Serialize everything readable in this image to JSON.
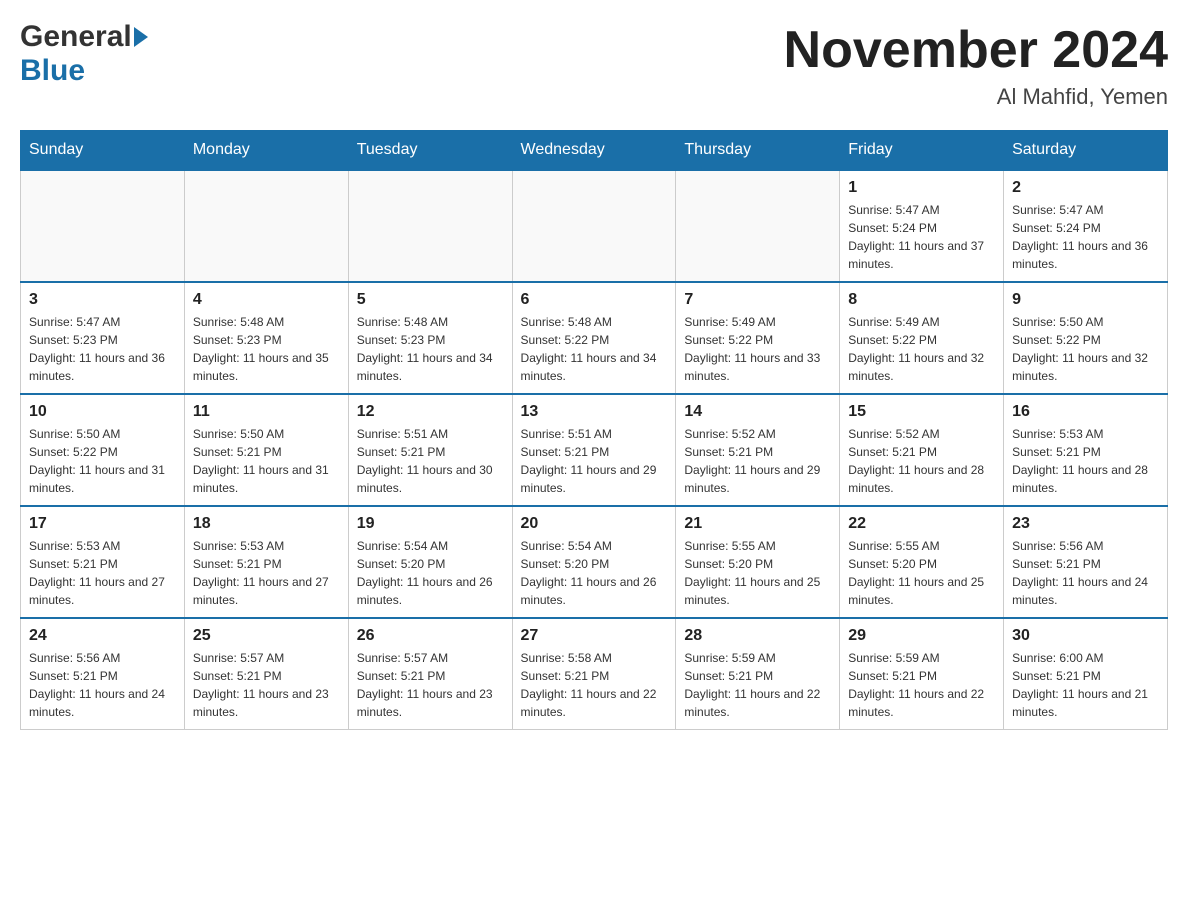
{
  "header": {
    "logo_general": "General",
    "logo_blue": "Blue",
    "month_title": "November 2024",
    "location": "Al Mahfid, Yemen"
  },
  "days_of_week": [
    "Sunday",
    "Monday",
    "Tuesday",
    "Wednesday",
    "Thursday",
    "Friday",
    "Saturday"
  ],
  "weeks": [
    [
      {
        "day": "",
        "sunrise": "",
        "sunset": "",
        "daylight": ""
      },
      {
        "day": "",
        "sunrise": "",
        "sunset": "",
        "daylight": ""
      },
      {
        "day": "",
        "sunrise": "",
        "sunset": "",
        "daylight": ""
      },
      {
        "day": "",
        "sunrise": "",
        "sunset": "",
        "daylight": ""
      },
      {
        "day": "",
        "sunrise": "",
        "sunset": "",
        "daylight": ""
      },
      {
        "day": "1",
        "sunrise": "Sunrise: 5:47 AM",
        "sunset": "Sunset: 5:24 PM",
        "daylight": "Daylight: 11 hours and 37 minutes."
      },
      {
        "day": "2",
        "sunrise": "Sunrise: 5:47 AM",
        "sunset": "Sunset: 5:24 PM",
        "daylight": "Daylight: 11 hours and 36 minutes."
      }
    ],
    [
      {
        "day": "3",
        "sunrise": "Sunrise: 5:47 AM",
        "sunset": "Sunset: 5:23 PM",
        "daylight": "Daylight: 11 hours and 36 minutes."
      },
      {
        "day": "4",
        "sunrise": "Sunrise: 5:48 AM",
        "sunset": "Sunset: 5:23 PM",
        "daylight": "Daylight: 11 hours and 35 minutes."
      },
      {
        "day": "5",
        "sunrise": "Sunrise: 5:48 AM",
        "sunset": "Sunset: 5:23 PM",
        "daylight": "Daylight: 11 hours and 34 minutes."
      },
      {
        "day": "6",
        "sunrise": "Sunrise: 5:48 AM",
        "sunset": "Sunset: 5:22 PM",
        "daylight": "Daylight: 11 hours and 34 minutes."
      },
      {
        "day": "7",
        "sunrise": "Sunrise: 5:49 AM",
        "sunset": "Sunset: 5:22 PM",
        "daylight": "Daylight: 11 hours and 33 minutes."
      },
      {
        "day": "8",
        "sunrise": "Sunrise: 5:49 AM",
        "sunset": "Sunset: 5:22 PM",
        "daylight": "Daylight: 11 hours and 32 minutes."
      },
      {
        "day": "9",
        "sunrise": "Sunrise: 5:50 AM",
        "sunset": "Sunset: 5:22 PM",
        "daylight": "Daylight: 11 hours and 32 minutes."
      }
    ],
    [
      {
        "day": "10",
        "sunrise": "Sunrise: 5:50 AM",
        "sunset": "Sunset: 5:22 PM",
        "daylight": "Daylight: 11 hours and 31 minutes."
      },
      {
        "day": "11",
        "sunrise": "Sunrise: 5:50 AM",
        "sunset": "Sunset: 5:21 PM",
        "daylight": "Daylight: 11 hours and 31 minutes."
      },
      {
        "day": "12",
        "sunrise": "Sunrise: 5:51 AM",
        "sunset": "Sunset: 5:21 PM",
        "daylight": "Daylight: 11 hours and 30 minutes."
      },
      {
        "day": "13",
        "sunrise": "Sunrise: 5:51 AM",
        "sunset": "Sunset: 5:21 PM",
        "daylight": "Daylight: 11 hours and 29 minutes."
      },
      {
        "day": "14",
        "sunrise": "Sunrise: 5:52 AM",
        "sunset": "Sunset: 5:21 PM",
        "daylight": "Daylight: 11 hours and 29 minutes."
      },
      {
        "day": "15",
        "sunrise": "Sunrise: 5:52 AM",
        "sunset": "Sunset: 5:21 PM",
        "daylight": "Daylight: 11 hours and 28 minutes."
      },
      {
        "day": "16",
        "sunrise": "Sunrise: 5:53 AM",
        "sunset": "Sunset: 5:21 PM",
        "daylight": "Daylight: 11 hours and 28 minutes."
      }
    ],
    [
      {
        "day": "17",
        "sunrise": "Sunrise: 5:53 AM",
        "sunset": "Sunset: 5:21 PM",
        "daylight": "Daylight: 11 hours and 27 minutes."
      },
      {
        "day": "18",
        "sunrise": "Sunrise: 5:53 AM",
        "sunset": "Sunset: 5:21 PM",
        "daylight": "Daylight: 11 hours and 27 minutes."
      },
      {
        "day": "19",
        "sunrise": "Sunrise: 5:54 AM",
        "sunset": "Sunset: 5:20 PM",
        "daylight": "Daylight: 11 hours and 26 minutes."
      },
      {
        "day": "20",
        "sunrise": "Sunrise: 5:54 AM",
        "sunset": "Sunset: 5:20 PM",
        "daylight": "Daylight: 11 hours and 26 minutes."
      },
      {
        "day": "21",
        "sunrise": "Sunrise: 5:55 AM",
        "sunset": "Sunset: 5:20 PM",
        "daylight": "Daylight: 11 hours and 25 minutes."
      },
      {
        "day": "22",
        "sunrise": "Sunrise: 5:55 AM",
        "sunset": "Sunset: 5:20 PM",
        "daylight": "Daylight: 11 hours and 25 minutes."
      },
      {
        "day": "23",
        "sunrise": "Sunrise: 5:56 AM",
        "sunset": "Sunset: 5:21 PM",
        "daylight": "Daylight: 11 hours and 24 minutes."
      }
    ],
    [
      {
        "day": "24",
        "sunrise": "Sunrise: 5:56 AM",
        "sunset": "Sunset: 5:21 PM",
        "daylight": "Daylight: 11 hours and 24 minutes."
      },
      {
        "day": "25",
        "sunrise": "Sunrise: 5:57 AM",
        "sunset": "Sunset: 5:21 PM",
        "daylight": "Daylight: 11 hours and 23 minutes."
      },
      {
        "day": "26",
        "sunrise": "Sunrise: 5:57 AM",
        "sunset": "Sunset: 5:21 PM",
        "daylight": "Daylight: 11 hours and 23 minutes."
      },
      {
        "day": "27",
        "sunrise": "Sunrise: 5:58 AM",
        "sunset": "Sunset: 5:21 PM",
        "daylight": "Daylight: 11 hours and 22 minutes."
      },
      {
        "day": "28",
        "sunrise": "Sunrise: 5:59 AM",
        "sunset": "Sunset: 5:21 PM",
        "daylight": "Daylight: 11 hours and 22 minutes."
      },
      {
        "day": "29",
        "sunrise": "Sunrise: 5:59 AM",
        "sunset": "Sunset: 5:21 PM",
        "daylight": "Daylight: 11 hours and 22 minutes."
      },
      {
        "day": "30",
        "sunrise": "Sunrise: 6:00 AM",
        "sunset": "Sunset: 5:21 PM",
        "daylight": "Daylight: 11 hours and 21 minutes."
      }
    ]
  ]
}
